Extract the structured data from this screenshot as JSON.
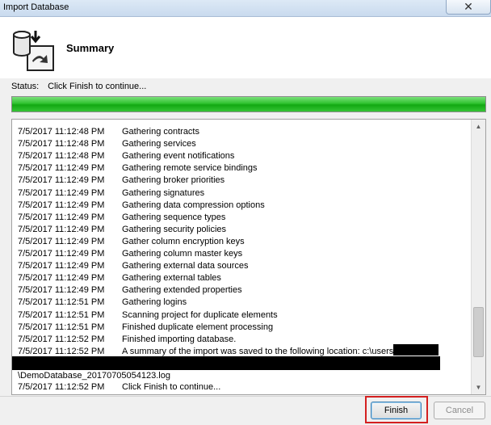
{
  "window": {
    "title": "Import Database",
    "close_glyph": "✕"
  },
  "header": {
    "heading": "Summary",
    "icon": "database-import-icon"
  },
  "status": {
    "label": "Status:",
    "text": "Click Finish to continue...",
    "progress": 1.0
  },
  "log": {
    "rows": [
      {
        "time": "7/5/2017 11:12:48 PM",
        "message": "Gathering contracts"
      },
      {
        "time": "7/5/2017 11:12:48 PM",
        "message": "Gathering services"
      },
      {
        "time": "7/5/2017 11:12:48 PM",
        "message": "Gathering event notifications"
      },
      {
        "time": "7/5/2017 11:12:49 PM",
        "message": "Gathering remote service bindings"
      },
      {
        "time": "7/5/2017 11:12:49 PM",
        "message": "Gathering broker priorities"
      },
      {
        "time": "7/5/2017 11:12:49 PM",
        "message": "Gathering signatures"
      },
      {
        "time": "7/5/2017 11:12:49 PM",
        "message": "Gathering data compression options"
      },
      {
        "time": "7/5/2017 11:12:49 PM",
        "message": "Gathering sequence types"
      },
      {
        "time": "7/5/2017 11:12:49 PM",
        "message": "Gathering security policies"
      },
      {
        "time": "7/5/2017 11:12:49 PM",
        "message": "Gather column encryption keys"
      },
      {
        "time": "7/5/2017 11:12:49 PM",
        "message": "Gathering column master keys"
      },
      {
        "time": "7/5/2017 11:12:49 PM",
        "message": "Gathering external data sources"
      },
      {
        "time": "7/5/2017 11:12:49 PM",
        "message": "Gathering external tables"
      },
      {
        "time": "7/5/2017 11:12:49 PM",
        "message": "Gathering extended properties"
      },
      {
        "time": "7/5/2017 11:12:51 PM",
        "message": "Gathering logins"
      },
      {
        "time": "7/5/2017 11:12:51 PM",
        "message": "Scanning project for duplicate elements"
      },
      {
        "time": "7/5/2017 11:12:51 PM",
        "message": "Finished duplicate element processing"
      },
      {
        "time": "7/5/2017 11:12:52 PM",
        "message": "Finished importing database."
      },
      {
        "time": "7/5/2017 11:12:52 PM",
        "message": "A summary of the import was saved to the following location: c:\\users\\"
      }
    ],
    "path_continuation": "\\DemoDatabase_20170705054123.log",
    "final_row": {
      "time": "7/5/2017 11:12:52 PM",
      "message": "Click Finish to continue..."
    }
  },
  "buttons": {
    "finish": "Finish",
    "cancel": "Cancel"
  }
}
